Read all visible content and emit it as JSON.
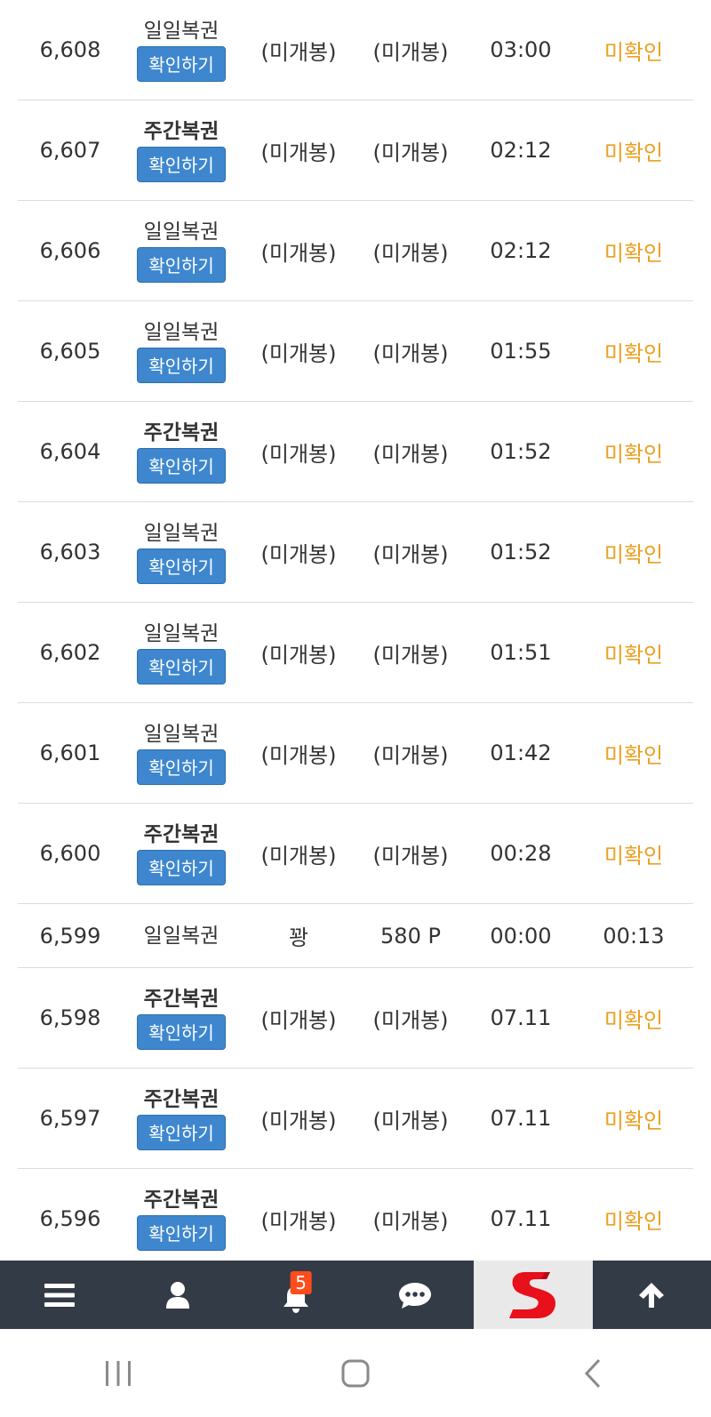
{
  "rows": [
    {
      "no": "6,608",
      "type": "일일복권",
      "type_bold": false,
      "button": "확인하기",
      "a": "(미개봉)",
      "b": "(미개봉)",
      "time": "03:00",
      "status": "미확인",
      "pending": true
    },
    {
      "no": "6,607",
      "type": "주간복권",
      "type_bold": true,
      "button": "확인하기",
      "a": "(미개봉)",
      "b": "(미개봉)",
      "time": "02:12",
      "status": "미확인",
      "pending": true
    },
    {
      "no": "6,606",
      "type": "일일복권",
      "type_bold": false,
      "button": "확인하기",
      "a": "(미개봉)",
      "b": "(미개봉)",
      "time": "02:12",
      "status": "미확인",
      "pending": true
    },
    {
      "no": "6,605",
      "type": "일일복권",
      "type_bold": false,
      "button": "확인하기",
      "a": "(미개봉)",
      "b": "(미개봉)",
      "time": "01:55",
      "status": "미확인",
      "pending": true
    },
    {
      "no": "6,604",
      "type": "주간복권",
      "type_bold": true,
      "button": "확인하기",
      "a": "(미개봉)",
      "b": "(미개봉)",
      "time": "01:52",
      "status": "미확인",
      "pending": true
    },
    {
      "no": "6,603",
      "type": "일일복권",
      "type_bold": false,
      "button": "확인하기",
      "a": "(미개봉)",
      "b": "(미개봉)",
      "time": "01:52",
      "status": "미확인",
      "pending": true
    },
    {
      "no": "6,602",
      "type": "일일복권",
      "type_bold": false,
      "button": "확인하기",
      "a": "(미개봉)",
      "b": "(미개봉)",
      "time": "01:51",
      "status": "미확인",
      "pending": true
    },
    {
      "no": "6,601",
      "type": "일일복권",
      "type_bold": false,
      "button": "확인하기",
      "a": "(미개봉)",
      "b": "(미개봉)",
      "time": "01:42",
      "status": "미확인",
      "pending": true
    },
    {
      "no": "6,600",
      "type": "주간복권",
      "type_bold": true,
      "button": "확인하기",
      "a": "(미개봉)",
      "b": "(미개봉)",
      "time": "00:28",
      "status": "미확인",
      "pending": true
    },
    {
      "no": "6,599",
      "type": "일일복권",
      "type_bold": false,
      "button": "",
      "a": "꽝",
      "b": "580 P",
      "time": "00:00",
      "status": "00:13",
      "pending": false
    },
    {
      "no": "6,598",
      "type": "주간복권",
      "type_bold": true,
      "button": "확인하기",
      "a": "(미개봉)",
      "b": "(미개봉)",
      "time": "07.11",
      "status": "미확인",
      "pending": true
    },
    {
      "no": "6,597",
      "type": "주간복권",
      "type_bold": true,
      "button": "확인하기",
      "a": "(미개봉)",
      "b": "(미개봉)",
      "time": "07.11",
      "status": "미확인",
      "pending": true
    },
    {
      "no": "6,596",
      "type": "주간복권",
      "type_bold": true,
      "button": "확인하기",
      "a": "(미개봉)",
      "b": "(미개봉)",
      "time": "07.11",
      "status": "미확인",
      "pending": true
    }
  ],
  "bottom_nav": {
    "items": [
      {
        "icon": "menu-icon"
      },
      {
        "icon": "user-icon"
      },
      {
        "icon": "bell-icon",
        "badge": "5"
      },
      {
        "icon": "chat-icon"
      },
      {
        "icon": "site-logo"
      },
      {
        "icon": "arrow-up-icon"
      }
    ]
  },
  "colors": {
    "accent_button": "#3e87cf",
    "pending_status": "#eba021",
    "nav_background": "#333b47",
    "badge": "#ff4c1c"
  }
}
